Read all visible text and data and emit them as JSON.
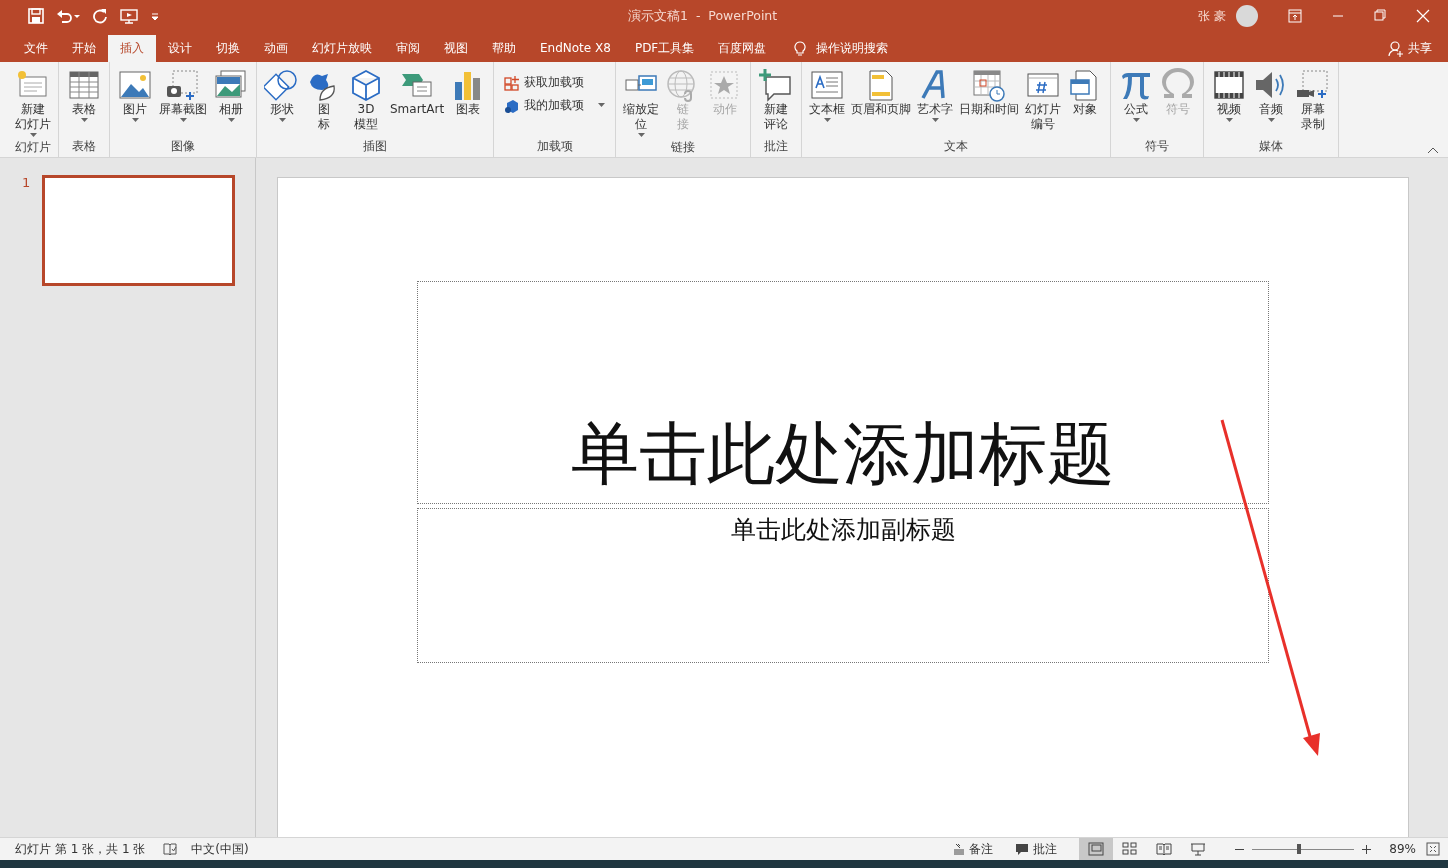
{
  "window": {
    "title": "演示文稿1  -  PowerPoint",
    "user": "张 豪"
  },
  "tabs": [
    {
      "label": "文件",
      "selected": false
    },
    {
      "label": "开始",
      "selected": false
    },
    {
      "label": "插入",
      "selected": true
    },
    {
      "label": "设计",
      "selected": false
    },
    {
      "label": "切换",
      "selected": false
    },
    {
      "label": "动画",
      "selected": false
    },
    {
      "label": "幻灯片放映",
      "selected": false
    },
    {
      "label": "审阅",
      "selected": false
    },
    {
      "label": "视图",
      "selected": false
    },
    {
      "label": "帮助",
      "selected": false
    },
    {
      "label": "EndNote X8",
      "selected": false
    },
    {
      "label": "PDF工具集",
      "selected": false
    },
    {
      "label": "百度网盘",
      "selected": false
    }
  ],
  "tell_me": "操作说明搜索",
  "share": "共享",
  "ribbon": {
    "groups": [
      {
        "label": "幻灯片",
        "buttons": [
          {
            "kind": "large",
            "lines": [
              "新建",
              "幻灯片"
            ],
            "dropdown": true,
            "disabled": false
          }
        ]
      },
      {
        "label": "表格",
        "buttons": [
          {
            "kind": "large",
            "lines": [
              "表格"
            ],
            "dropdown": true,
            "disabled": false
          }
        ]
      },
      {
        "label": "图像",
        "buttons": [
          {
            "kind": "large",
            "lines": [
              "图片"
            ],
            "dropdown": true,
            "disabled": false
          },
          {
            "kind": "large",
            "lines": [
              "屏幕截图"
            ],
            "dropdown": true,
            "disabled": false
          },
          {
            "kind": "large",
            "lines": [
              "相册"
            ],
            "dropdown": true,
            "disabled": false
          }
        ]
      },
      {
        "label": "插图",
        "buttons": [
          {
            "kind": "large",
            "lines": [
              "形状"
            ],
            "dropdown": true,
            "disabled": false
          },
          {
            "kind": "large",
            "lines": [
              "图",
              "标"
            ],
            "dropdown": false,
            "disabled": false
          },
          {
            "kind": "large",
            "lines": [
              "3D",
              "模型"
            ],
            "dropdown": false,
            "disabled": false
          },
          {
            "kind": "large",
            "lines": [
              "SmartArt"
            ],
            "dropdown": false,
            "disabled": false
          },
          {
            "kind": "large",
            "lines": [
              "图表"
            ],
            "dropdown": false,
            "disabled": false
          }
        ]
      },
      {
        "label": "加载项",
        "buttons": [
          {
            "kind": "small",
            "lines": [
              "获取加载项"
            ],
            "dropdown": false,
            "disabled": false
          },
          {
            "kind": "small",
            "lines": [
              "我的加载项"
            ],
            "dropdown": true,
            "disabled": false
          }
        ]
      },
      {
        "label": "链接",
        "buttons": [
          {
            "kind": "large",
            "lines": [
              "缩放定",
              "位"
            ],
            "dropdown": true,
            "disabled": false
          },
          {
            "kind": "large",
            "lines": [
              "链",
              "接"
            ],
            "dropdown": false,
            "disabled": true
          },
          {
            "kind": "large",
            "lines": [
              "动作"
            ],
            "dropdown": false,
            "disabled": true
          }
        ]
      },
      {
        "label": "批注",
        "buttons": [
          {
            "kind": "large",
            "lines": [
              "新建",
              "评论"
            ],
            "dropdown": false,
            "disabled": false
          }
        ]
      },
      {
        "label": "文本",
        "buttons": [
          {
            "kind": "large",
            "lines": [
              "文本框"
            ],
            "dropdown": true,
            "disabled": false
          },
          {
            "kind": "large",
            "lines": [
              "页眉和页脚"
            ],
            "dropdown": false,
            "disabled": false
          },
          {
            "kind": "large",
            "lines": [
              "艺术字"
            ],
            "dropdown": true,
            "disabled": false
          },
          {
            "kind": "large",
            "lines": [
              "日期和时间"
            ],
            "dropdown": false,
            "disabled": false
          },
          {
            "kind": "large",
            "lines": [
              "幻灯片",
              "编号"
            ],
            "dropdown": false,
            "disabled": false
          },
          {
            "kind": "large",
            "lines": [
              "对象"
            ],
            "dropdown": false,
            "disabled": false
          }
        ]
      },
      {
        "label": "符号",
        "buttons": [
          {
            "kind": "large",
            "lines": [
              "公式"
            ],
            "dropdown": true,
            "disabled": false
          },
          {
            "kind": "large",
            "lines": [
              "符号"
            ],
            "dropdown": false,
            "disabled": true
          }
        ]
      },
      {
        "label": "媒体",
        "buttons": [
          {
            "kind": "large",
            "lines": [
              "视频"
            ],
            "dropdown": true,
            "disabled": false
          },
          {
            "kind": "large",
            "lines": [
              "音频"
            ],
            "dropdown": true,
            "disabled": false
          },
          {
            "kind": "large",
            "lines": [
              "屏幕",
              "录制"
            ],
            "dropdown": false,
            "disabled": false
          }
        ]
      }
    ]
  },
  "thumbnails": [
    {
      "number": "1",
      "selected": true
    }
  ],
  "slide": {
    "title_placeholder": "单击此处添加标题",
    "subtitle_placeholder": "单击此处添加副标题"
  },
  "status_bar": {
    "slide_info": "幻灯片 第 1 张，共 1 张",
    "language": "中文(中国)",
    "notes": "备注",
    "comments": "批注",
    "views": [
      {
        "selected": true
      },
      {
        "selected": false
      },
      {
        "selected": false
      },
      {
        "selected": false
      }
    ],
    "zoom": {
      "level": 0.46,
      "reading": "89%"
    }
  }
}
